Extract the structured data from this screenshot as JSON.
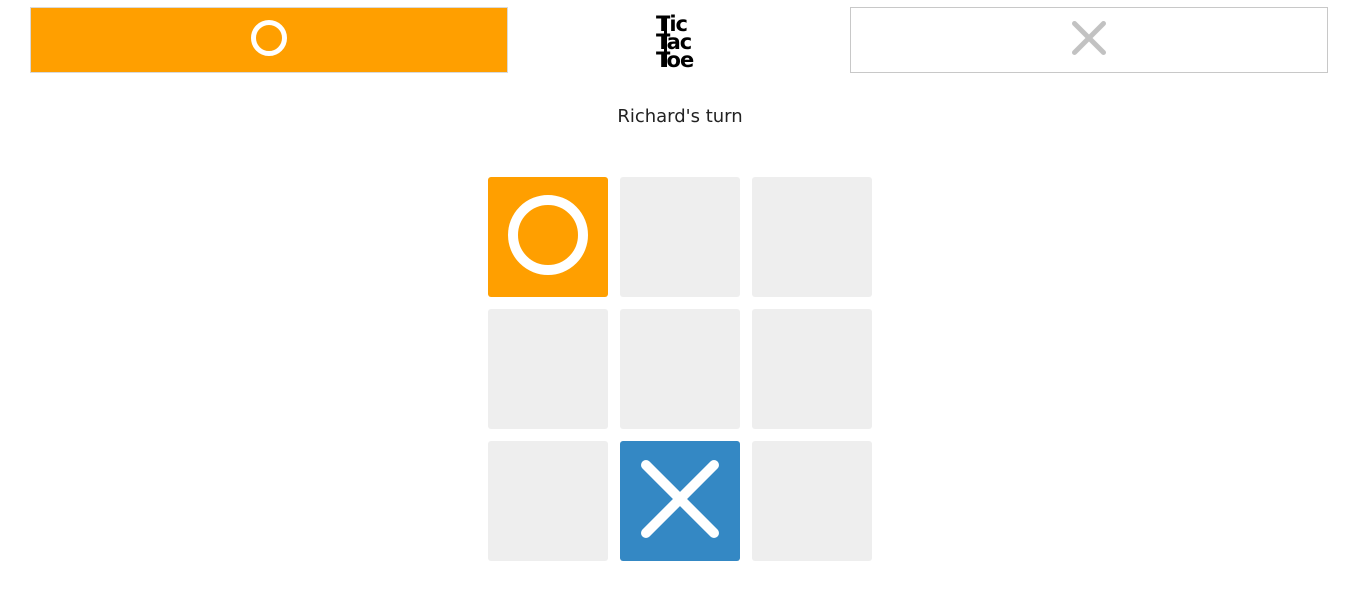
{
  "header": {
    "logo": [
      "Tic",
      "Tac",
      "Toe"
    ],
    "player_o": {
      "mark": "O",
      "active": true
    },
    "player_x": {
      "mark": "X",
      "active": false
    }
  },
  "status": {
    "turn_text": "Richard's turn"
  },
  "board": {
    "cells": [
      "O",
      "",
      "",
      "",
      "",
      "",
      "",
      "X",
      ""
    ]
  },
  "colors": {
    "o": "#ff9f00",
    "x": "#3488c4",
    "empty_cell": "#eeeeee",
    "inactive_mark": "#c2c2c2",
    "mark_on_color": "#ffffff"
  }
}
